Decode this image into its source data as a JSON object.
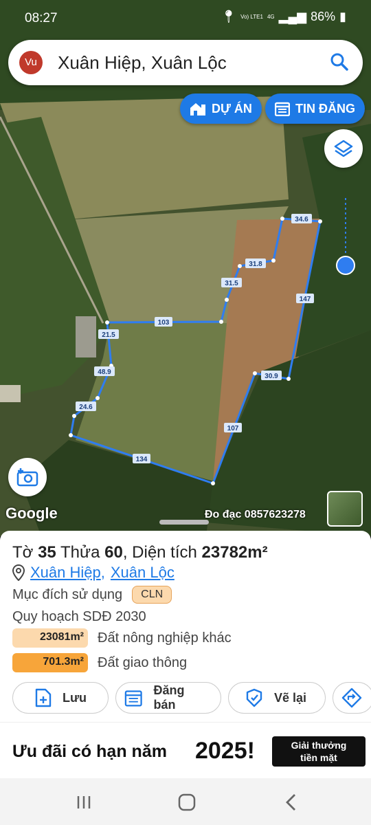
{
  "status": {
    "time": "08:27",
    "net": "Vo) LTE1",
    "net_small": "4G",
    "battery": "86%"
  },
  "search": {
    "avatar": "Vu",
    "query": "Xuân Hiệp, Xuân Lộc",
    "icon": "search-icon"
  },
  "pills": {
    "projects": "DỰ ÁN",
    "listings": "TIN ĐĂNG"
  },
  "map": {
    "boundary_color": "#2f7df0",
    "edges": [
      "34.6",
      "147",
      "31.8",
      "31.5",
      "103",
      "21.5",
      "48.9",
      "24.6",
      "134",
      "107",
      "30.9"
    ],
    "google": "Google",
    "credit": "Đo đạc 0857623278"
  },
  "parcel": {
    "title_prefix": "Tờ",
    "sheet_no": "35",
    "parcel_label": "Thửa",
    "parcel_no": "60",
    "area_label": ", Diện tích",
    "area": "23782m²",
    "commune": "Xuân Hiệp",
    "district": "Xuân Lộc",
    "sep": ",",
    "purpose_label": "Mục đích sử dụng",
    "purpose_code": "CLN",
    "plan_label": "Quy hoạch SDĐ 2030",
    "plans": [
      {
        "area": "23081m²",
        "name": "Đất nông nghiệp khác",
        "color": "#fcd9ad"
      },
      {
        "area": "701.3m²",
        "name": "Đất giao thông",
        "color": "#f7a53a"
      }
    ]
  },
  "actions": {
    "save": "Lưu",
    "sell": "Đăng bán",
    "redraw": "Vẽ lại"
  },
  "promo": {
    "text": "Ưu đãi có hạn năm",
    "year": "2025!",
    "button_line1": "Giải thưởng",
    "button_line2": "tiền mặt"
  }
}
